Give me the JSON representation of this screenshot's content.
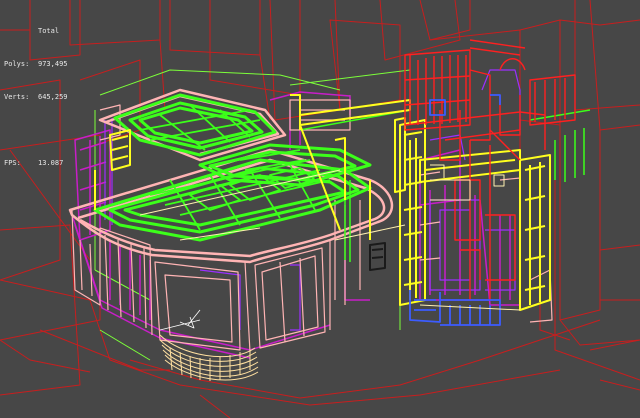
{
  "stats": {
    "total_label": "Total",
    "polys_label": "Polys:",
    "polys_value": "973,495",
    "verts_label": "Verts:",
    "verts_value": "645,259",
    "fps_label": "FPS:",
    "fps_value": "13.087"
  },
  "colors": {
    "background": "#474747",
    "bbox_red": "#c81e1e",
    "bright_red": "#ff2020",
    "green": "#3cff1a",
    "yellow": "#ffff1e",
    "magenta": "#c81ec8",
    "violet": "#9b30ff",
    "pink": "#ffb4b4",
    "cream": "#fff0b0",
    "blue": "#3c5cff"
  }
}
